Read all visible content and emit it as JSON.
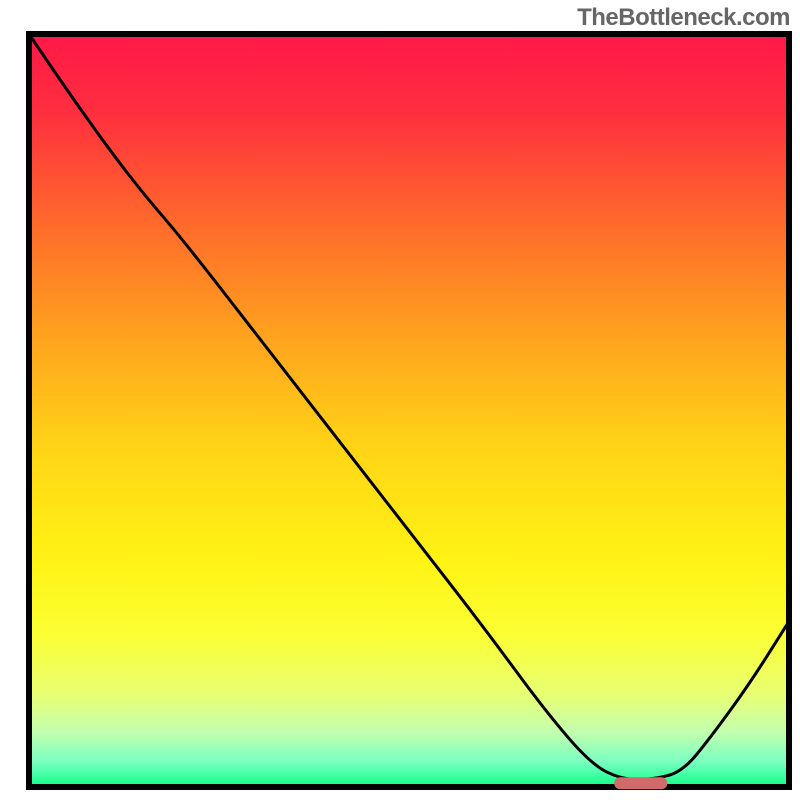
{
  "watermark": "TheBottleneck.com",
  "chart_data": {
    "type": "line",
    "title": "",
    "xlabel": "",
    "ylabel": "",
    "xlim": [
      0,
      100
    ],
    "ylim": [
      0,
      100
    ],
    "grid": false,
    "legend": false,
    "series": [
      {
        "name": "curve",
        "color": "#000000",
        "x": [
          0,
          6,
          14,
          20,
          30,
          40,
          50,
          60,
          68,
          74,
          78,
          82,
          86,
          90,
          95,
          100
        ],
        "y": [
          100,
          91,
          80,
          73,
          60,
          47,
          34,
          21,
          10,
          3,
          1,
          1,
          2,
          7,
          14,
          22
        ]
      }
    ],
    "marker": {
      "name": "optimal-marker",
      "color": "#d16a6a",
      "x_start": 77,
      "x_end": 84,
      "y": 0.5,
      "rx": 3
    },
    "gradient_stops": [
      {
        "offset": 0.0,
        "color": "#ff1948"
      },
      {
        "offset": 0.1,
        "color": "#ff2e3f"
      },
      {
        "offset": 0.25,
        "color": "#ff6a2b"
      },
      {
        "offset": 0.4,
        "color": "#ffa21e"
      },
      {
        "offset": 0.55,
        "color": "#ffd416"
      },
      {
        "offset": 0.7,
        "color": "#fff314"
      },
      {
        "offset": 0.8,
        "color": "#fbff33"
      },
      {
        "offset": 0.88,
        "color": "#e8ff74"
      },
      {
        "offset": 0.93,
        "color": "#c3ffae"
      },
      {
        "offset": 0.97,
        "color": "#7affc1"
      },
      {
        "offset": 1.0,
        "color": "#1aff8e"
      }
    ],
    "frame_color": "#000000",
    "frame_width": 6
  }
}
